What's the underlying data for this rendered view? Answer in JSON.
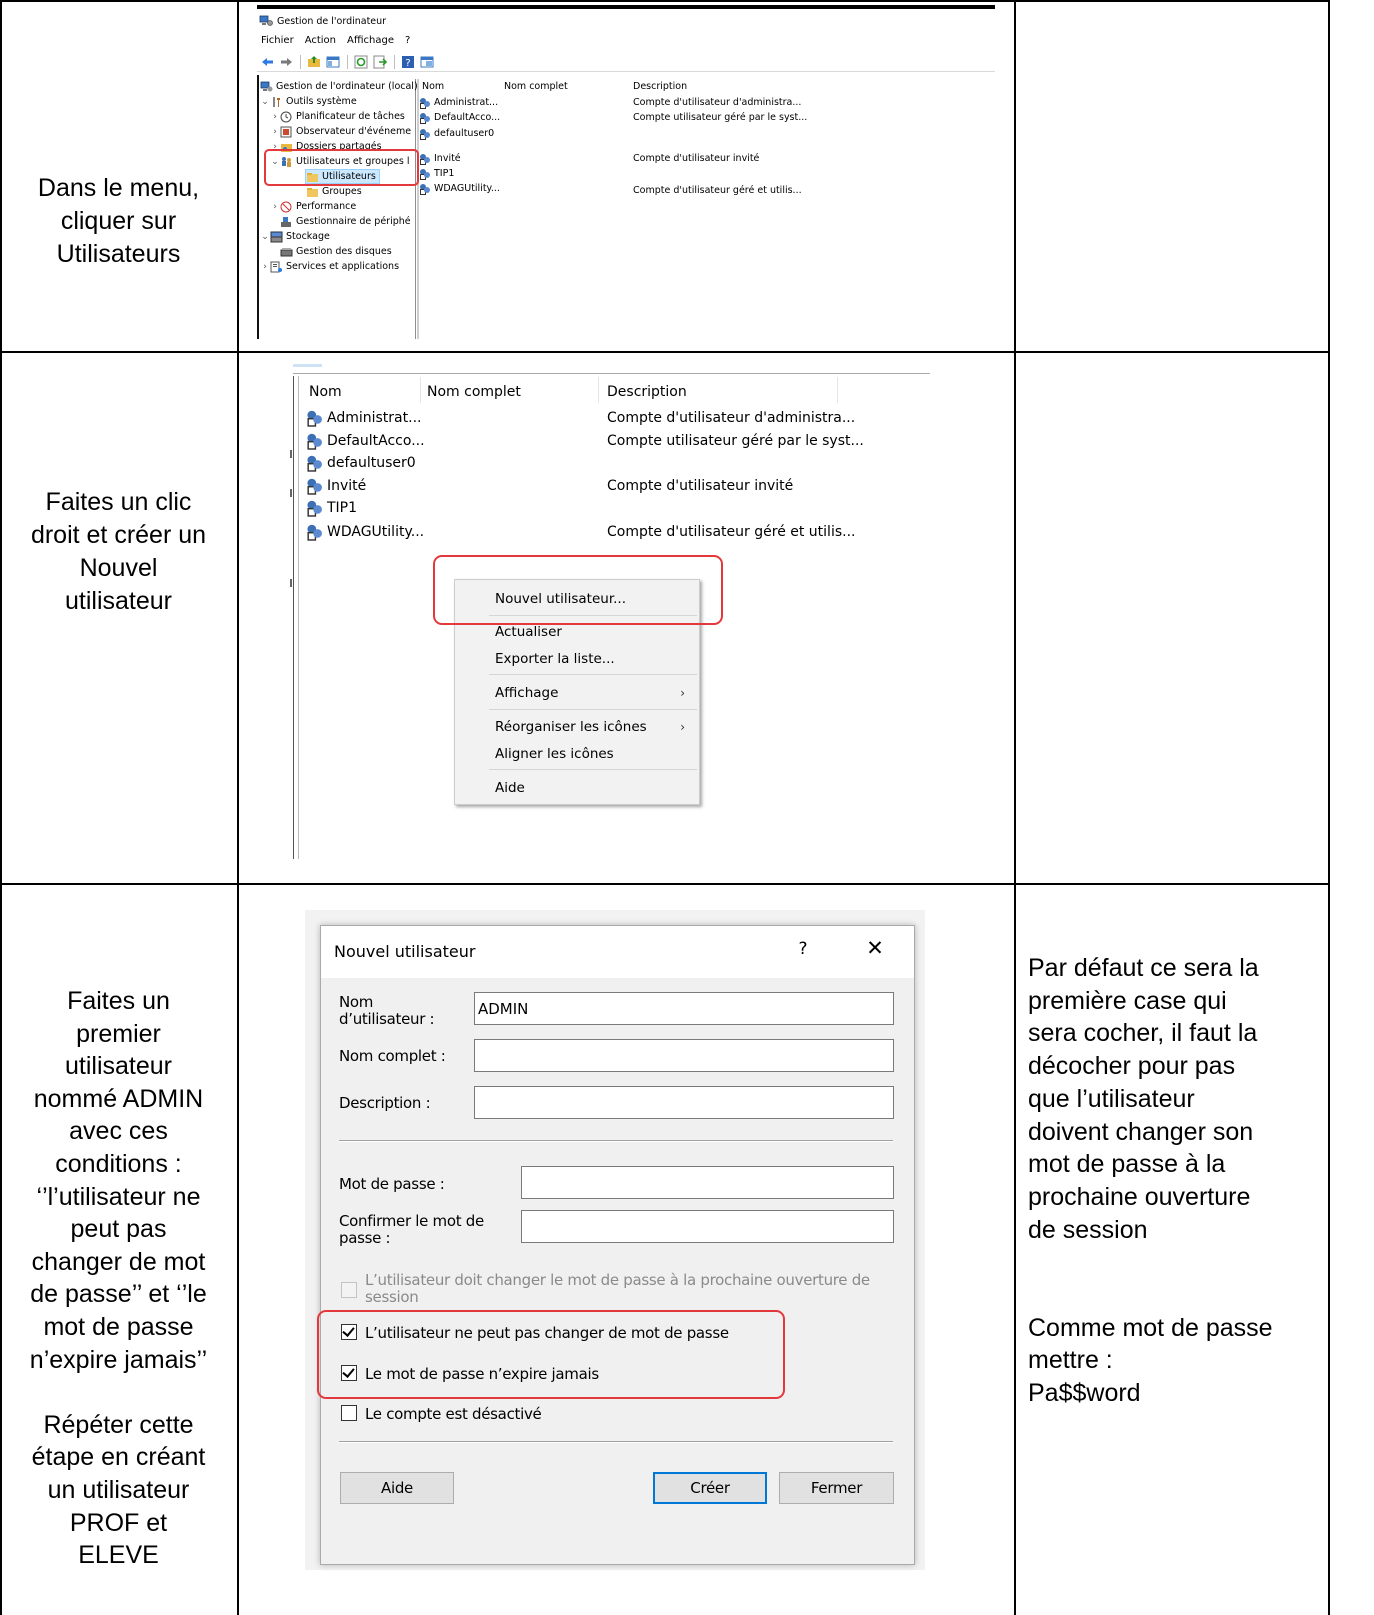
{
  "rows": [
    {
      "instruction_lines": [
        "Dans le menu,",
        "cliquer sur",
        "Utilisateurs"
      ],
      "note_lines": []
    },
    {
      "instruction_lines": [
        "Faites un clic",
        "droit et créer un",
        "Nouvel",
        "utilisateur"
      ],
      "note_lines": []
    },
    {
      "instruction_lines": [
        "Faites un",
        "premier",
        "utilisateur",
        "nommé ADMIN",
        "avec ces",
        "conditions :",
        "‘’l’utilisateur ne",
        "peut pas",
        "changer de mot",
        "de passe’’ et ‘’le",
        "mot de passe",
        "n’expire jamais’’",
        "",
        "Répéter cette",
        "étape en créant",
        "un utilisateur",
        "PROF et",
        "ELEVE"
      ],
      "note_lines": [
        "Par défaut ce sera la",
        "première case qui",
        "sera cocher, il faut la",
        "décocher pour pas",
        "que l’utilisateur",
        "doivent changer son",
        "mot de passe à la",
        "prochaine ouverture",
        "de session",
        "",
        "",
        "Comme mot de passe",
        "mettre :",
        "Pa$$word"
      ]
    }
  ],
  "shot1": {
    "window_title": "Gestion de l'ordinateur",
    "menu": [
      "Fichier",
      "Action",
      "Affichage",
      "?"
    ],
    "tree": [
      {
        "label": "Gestion de l'ordinateur (local)"
      },
      {
        "label": "Outils système"
      },
      {
        "label": "Planificateur de tâches"
      },
      {
        "label": "Observateur d'événeme"
      },
      {
        "label": "Dossiers partagés"
      },
      {
        "label": "Utilisateurs et groupes l"
      },
      {
        "label": "Utilisateurs"
      },
      {
        "label": "Groupes"
      },
      {
        "label": "Performance"
      },
      {
        "label": "Gestionnaire de périphé"
      },
      {
        "label": "Stockage"
      },
      {
        "label": "Gestion des disques"
      },
      {
        "label": "Services et applications"
      }
    ],
    "columns": [
      "Nom",
      "Nom complet",
      "Description"
    ],
    "users": [
      {
        "name": "Administrat...",
        "description": "Compte d'utilisateur d'administra..."
      },
      {
        "name": "DefaultAcco...",
        "description": "Compte utilisateur géré par le syst..."
      },
      {
        "name": "defaultuser0",
        "description": ""
      },
      {
        "name": "Invité",
        "description": "Compte d'utilisateur invité"
      },
      {
        "name": "TIP1",
        "description": ""
      },
      {
        "name": "WDAGUtility...",
        "description": "Compte d'utilisateur géré et utilis..."
      }
    ]
  },
  "shot2": {
    "columns": [
      "Nom",
      "Nom complet",
      "Description"
    ],
    "users": [
      {
        "name": "Administrat...",
        "description": "Compte d'utilisateur d'administra..."
      },
      {
        "name": "DefaultAcco...",
        "description": "Compte utilisateur géré par le syst..."
      },
      {
        "name": "defaultuser0",
        "description": ""
      },
      {
        "name": "Invité",
        "description": "Compte d'utilisateur invité"
      },
      {
        "name": "TIP1",
        "description": ""
      },
      {
        "name": "WDAGUtility...",
        "description": "Compte d'utilisateur géré et utilis..."
      }
    ],
    "context_menu": [
      {
        "label": "Nouvel utilisateur..."
      },
      {
        "label": "Actualiser"
      },
      {
        "label": "Exporter la liste..."
      },
      {
        "label": "Affichage",
        "submenu": "›"
      },
      {
        "label": "Réorganiser les icônes",
        "submenu": "›"
      },
      {
        "label": "Aligner les icônes"
      },
      {
        "label": "Aide"
      }
    ]
  },
  "dialog": {
    "title": "Nouvel utilisateur",
    "help": "?",
    "close": "✕",
    "username_label_1": "Nom",
    "username_label_2": "d’utilisateur :",
    "username_value": "ADMIN",
    "fullname_label": "Nom complet :",
    "description_label": "Description :",
    "password_label": "Mot de passe :",
    "confirm_label_1": "Confirmer le mot de",
    "confirm_label_2": "passe :",
    "checkboxes": [
      {
        "label_1": "L’utilisateur doit changer le mot de passe à la prochaine ouverture de",
        "label_2": "session",
        "checked": false,
        "disabled": true
      },
      {
        "label_1": "L’utilisateur ne peut pas changer de mot de passe",
        "checked": true,
        "disabled": false
      },
      {
        "label_1": "Le mot de passe n’expire jamais",
        "checked": true,
        "disabled": false
      },
      {
        "label_1": "Le compte est désactivé",
        "checked": false,
        "disabled": false
      }
    ],
    "buttons": {
      "help": "Aide",
      "create": "Créer",
      "close": "Fermer"
    },
    "highlight_color": "#e4393c"
  }
}
